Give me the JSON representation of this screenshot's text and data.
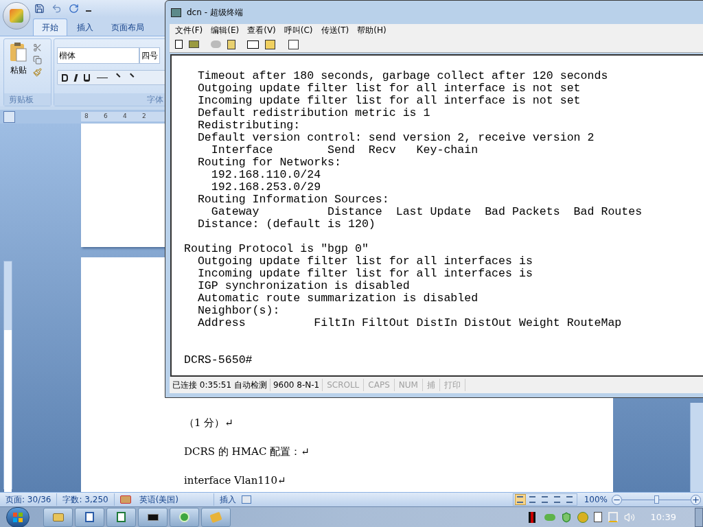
{
  "word": {
    "ribbon_tabs": [
      {
        "label": "开始",
        "selected": true
      },
      {
        "label": "插入",
        "selected": false
      },
      {
        "label": "页面布局",
        "selected": false
      }
    ],
    "clipboard": {
      "paste_label": "粘贴",
      "group_label": "剪贴板"
    },
    "font": {
      "font_name": "楷体",
      "font_size": "四号",
      "group_label": "字体"
    },
    "ruler_numbers": [
      "8",
      "6",
      "4",
      "2"
    ],
    "document_lines": [
      "（1 分）↵",
      "DCRS 的 HMAC 配置：↵",
      "interface Vlan110↵"
    ],
    "status_bar": {
      "page": "页面: 30/36",
      "words": "字数: 3,250",
      "language": "英语(美国)",
      "mode": "插入",
      "zoom": "100%",
      "zoom_slider": {
        "level": 0.5
      },
      "view_buttons": [
        {
          "selected": true
        },
        {
          "selected": false
        },
        {
          "selected": false
        },
        {
          "selected": false
        },
        {
          "selected": false
        }
      ]
    }
  },
  "terminal": {
    "title": "dcn - 超级终端",
    "menu": [
      "文件(F)",
      "编辑(E)",
      "查看(V)",
      "呼叫(C)",
      "传送(T)",
      "帮助(H)"
    ],
    "sections": [
      [
        "  Timeout after 180 seconds, garbage collect after 120 seconds",
        "  Outgoing update filter list for all interface is not set",
        "  Incoming update filter list for all interface is not set",
        "  Default redistribution metric is 1",
        "  Redistributing:",
        "  Default version control: send version 2, receive version 2",
        "    Interface        Send  Recv   Key-chain",
        "  Routing for Networks:",
        "    192.168.110.0/24",
        "    192.168.253.0/29",
        "  Routing Information Sources:",
        "    Gateway          Distance  Last Update  Bad Packets  Bad Routes",
        "  Distance: (default is 120)"
      ],
      [
        "Routing Protocol is \"bgp 0\"",
        "  Outgoing update filter list for all interfaces is",
        "  Incoming update filter list for all interfaces is",
        "  IGP synchronization is disabled",
        "  Automatic route summarization is disabled",
        "  Neighbor(s):",
        "  Address          FiltIn FiltOut DistIn DistOut Weight RouteMap"
      ]
    ],
    "prompt": "DCRS-5650#",
    "status_fields": [
      {
        "text": "已连接 0:35:51 自动检测",
        "on": true
      },
      {
        "text": "9600 8-N-1",
        "on": true
      },
      {
        "text": "SCROLL",
        "on": false
      },
      {
        "text": "CAPS",
        "on": false
      },
      {
        "text": "NUM",
        "on": false
      },
      {
        "text": "捕",
        "on": false
      },
      {
        "text": "打印",
        "on": false
      }
    ]
  },
  "taskbar": {
    "clock": "10:39"
  }
}
